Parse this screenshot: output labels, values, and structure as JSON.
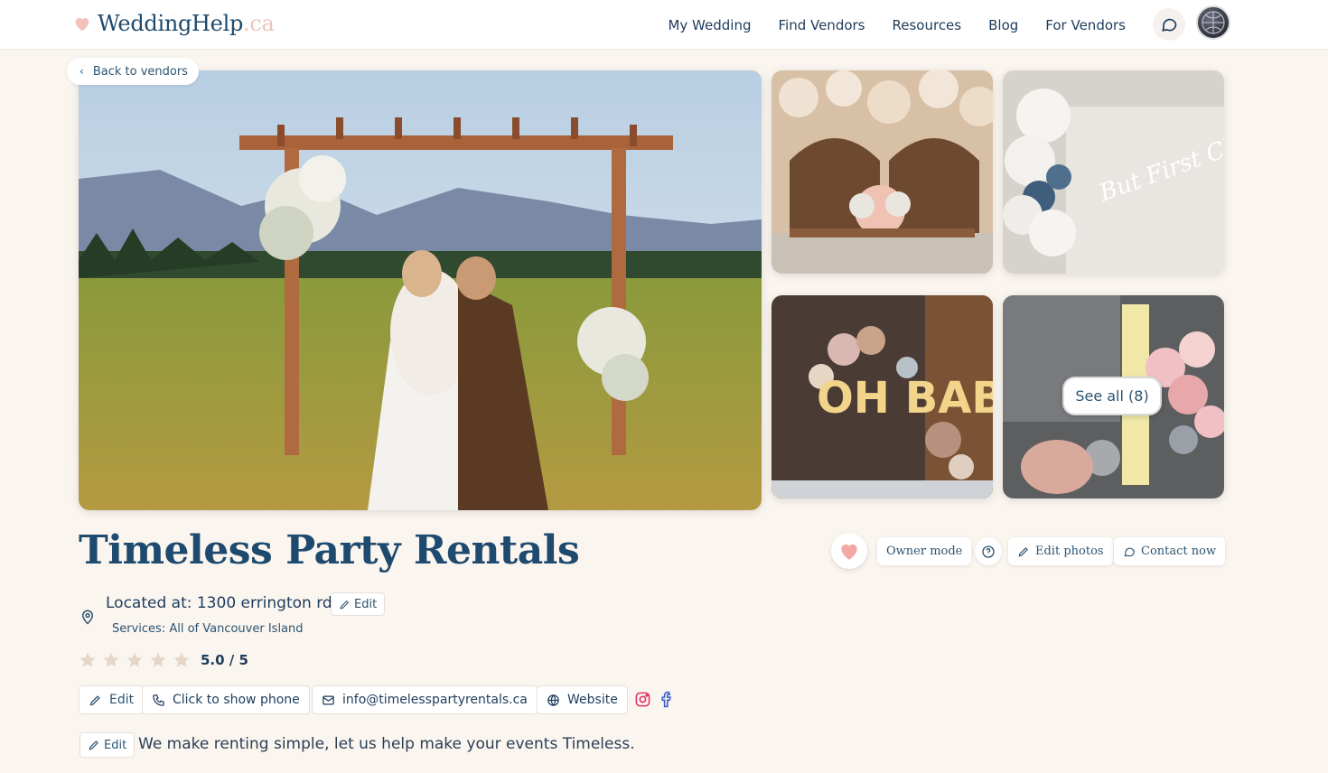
{
  "header": {
    "logo_main": "WeddingHelp",
    "logo_ext": ".ca",
    "nav": [
      "My Wedding",
      "Find Vendors",
      "Resources",
      "Blog",
      "For Vendors"
    ]
  },
  "back_label": "Back to vendors",
  "gallery": {
    "see_all": "See all (8)",
    "thumb_texts": {
      "neon": "But First Champagne",
      "marquee": "OH BABY"
    }
  },
  "vendor": {
    "name": "Timeless Party Rentals",
    "location": "Located at: 1300 errington rd",
    "services": "Services: All of Vancouver Island",
    "rating": "5.0 / 5",
    "stars": 5,
    "description": "We make renting simple, let us help make your events Timeless."
  },
  "actions": {
    "owner_mode": "Owner mode",
    "edit_photos": "Edit photos",
    "contact_now": "Contact now",
    "edit": "Edit"
  },
  "contact": {
    "phone": "Click to show phone",
    "email": "info@timelesspartyrentals.ca",
    "website": "Website"
  },
  "colors": {
    "brand": "#1d4a6e",
    "accent": "#ecc3bc",
    "background": "#fbf5ef"
  }
}
